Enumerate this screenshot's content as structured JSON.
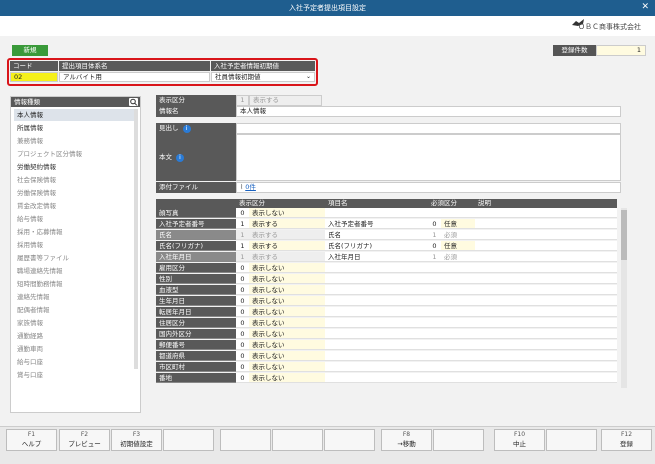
{
  "window": {
    "title": "入社予定者提出項目設定",
    "close": "✕"
  },
  "company": {
    "name": "ＯＢＣ商事株式会社"
  },
  "toolbar": {
    "new_label": "新規",
    "count_label": "登録件数",
    "count_value": "1"
  },
  "header_table": {
    "columns": [
      "コード",
      "提出項目体系名",
      "入社予定者情報初期値"
    ],
    "values": {
      "code": "02",
      "name": "アルバイト用",
      "initial": "社員情報初期値"
    }
  },
  "left_panel": {
    "title": "情報種類",
    "items": [
      {
        "label": "本人情報",
        "state": "selected"
      },
      {
        "label": "所属情報",
        "state": "enabled"
      },
      {
        "label": "兼務情報",
        "state": "disabled"
      },
      {
        "label": "プロジェクト区分情報",
        "state": "disabled"
      },
      {
        "label": "労働契約情報",
        "state": "enabled"
      },
      {
        "label": "社会保険情報",
        "state": "disabled"
      },
      {
        "label": "労働保険情報",
        "state": "disabled"
      },
      {
        "label": "賃金改定情報",
        "state": "disabled"
      },
      {
        "label": "給与情報",
        "state": "disabled"
      },
      {
        "label": "採用・応募情報",
        "state": "disabled"
      },
      {
        "label": "採用情報",
        "state": "disabled"
      },
      {
        "label": "履歴書等ファイル",
        "state": "disabled"
      },
      {
        "label": "職場連絡先情報",
        "state": "disabled"
      },
      {
        "label": "短時間勤務情報",
        "state": "disabled"
      },
      {
        "label": "連絡先情報",
        "state": "disabled"
      },
      {
        "label": "配偶者情報",
        "state": "disabled"
      },
      {
        "label": "家族情報",
        "state": "disabled"
      },
      {
        "label": "通勤経路",
        "state": "disabled"
      },
      {
        "label": "通勤車両",
        "state": "disabled"
      },
      {
        "label": "給与口座",
        "state": "disabled"
      },
      {
        "label": "賞与口座",
        "state": "disabled"
      }
    ]
  },
  "info": {
    "display_label": "表示区分",
    "display_num": "1",
    "display_text": "表示する",
    "name_label": "情報名",
    "name_value": "本人情報",
    "heading_label": "見出し",
    "body_label": "本文",
    "attach_label": "添付ファイル",
    "attach_value": "0件"
  },
  "grid": {
    "headers": [
      "表示区分",
      "項目名",
      "必須区分",
      "説明"
    ],
    "rows": [
      {
        "item": "顔写真",
        "dnum": "0",
        "dtext": "表示しない",
        "name": "",
        "rnum": "",
        "rtext": "",
        "dim": false
      },
      {
        "item": "入社予定者番号",
        "dnum": "1",
        "dtext": "表示する",
        "name": "入社予定者番号",
        "rnum": "0",
        "rtext": "任意",
        "dim": false
      },
      {
        "item": "氏名",
        "dnum": "1",
        "dtext": "表示する",
        "name": "氏名",
        "rnum": "1",
        "rtext": "必須",
        "dim": true
      },
      {
        "item": "氏名(フリガナ)",
        "dnum": "1",
        "dtext": "表示する",
        "name": "氏名(フリガナ)",
        "rnum": "0",
        "rtext": "任意",
        "dim": false
      },
      {
        "item": "入社年月日",
        "dnum": "1",
        "dtext": "表示する",
        "name": "入社年月日",
        "rnum": "1",
        "rtext": "必須",
        "dim": true
      },
      {
        "item": "雇用区分",
        "dnum": "0",
        "dtext": "表示しない",
        "name": "",
        "rnum": "",
        "rtext": "",
        "dim": false
      },
      {
        "item": "性別",
        "dnum": "0",
        "dtext": "表示しない",
        "name": "",
        "rnum": "",
        "rtext": "",
        "dim": false
      },
      {
        "item": "血液型",
        "dnum": "0",
        "dtext": "表示しない",
        "name": "",
        "rnum": "",
        "rtext": "",
        "dim": false
      },
      {
        "item": "生年月日",
        "dnum": "0",
        "dtext": "表示しない",
        "name": "",
        "rnum": "",
        "rtext": "",
        "dim": false
      },
      {
        "item": "転居年月日",
        "dnum": "0",
        "dtext": "表示しない",
        "name": "",
        "rnum": "",
        "rtext": "",
        "dim": false
      },
      {
        "item": "住居区分",
        "dnum": "0",
        "dtext": "表示しない",
        "name": "",
        "rnum": "",
        "rtext": "",
        "dim": false
      },
      {
        "item": "国内外区分",
        "dnum": "0",
        "dtext": "表示しない",
        "name": "",
        "rnum": "",
        "rtext": "",
        "dim": false
      },
      {
        "item": "郵便番号",
        "dnum": "0",
        "dtext": "表示しない",
        "name": "",
        "rnum": "",
        "rtext": "",
        "dim": false
      },
      {
        "item": "都道府県",
        "dnum": "0",
        "dtext": "表示しない",
        "name": "",
        "rnum": "",
        "rtext": "",
        "dim": false
      },
      {
        "item": "市区町村",
        "dnum": "0",
        "dtext": "表示しない",
        "name": "",
        "rnum": "",
        "rtext": "",
        "dim": false
      },
      {
        "item": "番地",
        "dnum": "0",
        "dtext": "表示しない",
        "name": "",
        "rnum": "",
        "rtext": "",
        "dim": false
      }
    ]
  },
  "fkeys": [
    {
      "key": "F1",
      "label": "ヘルプ"
    },
    {
      "key": "F2",
      "label": "プレビュー"
    },
    {
      "key": "F3",
      "label": "初期値設定"
    },
    {
      "key": "",
      "label": ""
    },
    {
      "key": "",
      "label": ""
    },
    {
      "key": "",
      "label": ""
    },
    {
      "key": "",
      "label": ""
    },
    {
      "key": "F8",
      "label": "→移動"
    },
    {
      "key": "",
      "label": ""
    },
    {
      "key": "F10",
      "label": "中止"
    },
    {
      "key": "",
      "label": ""
    },
    {
      "key": "F12",
      "label": "登録"
    }
  ]
}
